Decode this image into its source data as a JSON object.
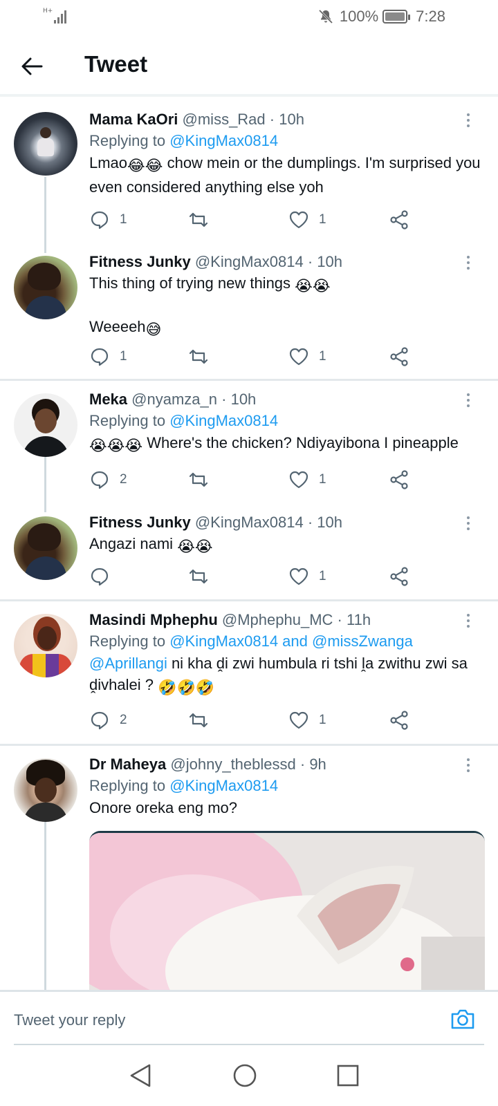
{
  "status": {
    "network": "H+",
    "battery": "100%",
    "time": "7:28"
  },
  "header": {
    "title": "Tweet"
  },
  "tweets": [
    {
      "name": "Mama KaOri",
      "handle": "@miss_Rad",
      "time": "· 10h",
      "reply_prefix": "Replying to",
      "reply_to": "@KingMax0814",
      "text_before_emoji": "Lmao",
      "emoji": "😂😂",
      "text_after_emoji": " chow mein or the dumplings. I'm surprised you even considered anything else yoh",
      "replies": "1",
      "retweets": "",
      "likes": "1"
    },
    {
      "name": "Fitness Junky",
      "handle": "@KingMax0814",
      "time": "· 10h",
      "line1": "This thing of trying new things ",
      "line1_emoji": "😭😭",
      "line2": "Weeeeh",
      "line2_emoji": "😅",
      "replies": "1",
      "retweets": "",
      "likes": "1"
    },
    {
      "name": "Meka",
      "handle": "@nyamza_n",
      "time": "· 10h",
      "reply_prefix": "Replying to",
      "reply_to": "@KingMax0814",
      "emoji": "😭😭😭",
      "text": " Where's the chicken? Ndiyayibona I pineapple",
      "replies": "2",
      "retweets": "",
      "likes": "1"
    },
    {
      "name": "Fitness Junky",
      "handle": "@KingMax0814",
      "time": "· 10h",
      "text": "Angazi nami ",
      "emoji": "😭😭",
      "replies": "",
      "retweets": "",
      "likes": "1"
    },
    {
      "name": "Masindi Mphephu",
      "handle": "@Mphephu_MC",
      "time": "· 11h",
      "reply_prefix": "Replying to",
      "reply_to": "@KingMax0814 and @missZwanga",
      "mention": "@Aprillangi",
      "text": " ni kha ḓi zwi humbula ri tshi ḽa zwithu zwi sa ḓivhalei ? ",
      "emoji": "🤣🤣🤣",
      "replies": "2",
      "retweets": "",
      "likes": "1"
    },
    {
      "name": "Dr Maheya",
      "handle": "@johny_theblessd",
      "time": "· 9h",
      "reply_prefix": "Replying to",
      "reply_to": "@KingMax0814",
      "text": "Onore oreka eng mo?"
    }
  ],
  "reply_bar": {
    "placeholder": "Tweet your reply"
  },
  "colors": {
    "link": "#1d9bf0",
    "secondary_text": "#536471",
    "primary_text": "#0f1419"
  }
}
